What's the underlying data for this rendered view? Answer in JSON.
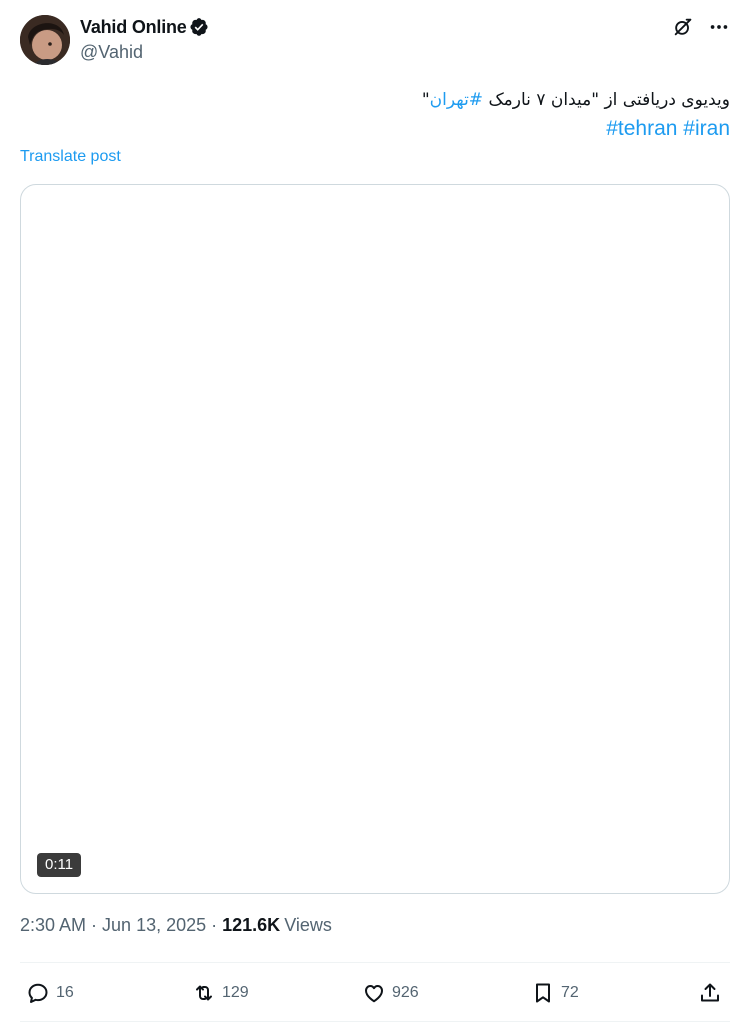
{
  "author": {
    "display_name": "Vahid Online",
    "handle": "@Vahid",
    "verified": true
  },
  "post": {
    "text_prefix": "ویدیوی دریافتی از \"میدان ۷ نارمک ",
    "text_hashtag": "#تهران",
    "text_suffix": "\"",
    "tags": [
      "#tehran",
      "#iran"
    ],
    "translate_label": "Translate post"
  },
  "media": {
    "type": "video",
    "duration": "0:11"
  },
  "meta": {
    "time": "2:30 AM",
    "date": "Jun 13, 2025",
    "views_count": "121.6K",
    "views_label": "Views",
    "separator": "·"
  },
  "actions": {
    "replies": "16",
    "reposts": "129",
    "likes": "926",
    "bookmarks": "72"
  },
  "icons": {
    "verified": "verified-badge-icon",
    "grok": "grok-icon",
    "more": "more-icon",
    "reply": "reply-icon",
    "repost": "repost-icon",
    "like": "heart-icon",
    "bookmark": "bookmark-icon",
    "share": "share-icon"
  },
  "colors": {
    "accent": "#1d9bf0",
    "text": "#0f1419",
    "muted": "#536471",
    "border": "#cfd9de"
  }
}
